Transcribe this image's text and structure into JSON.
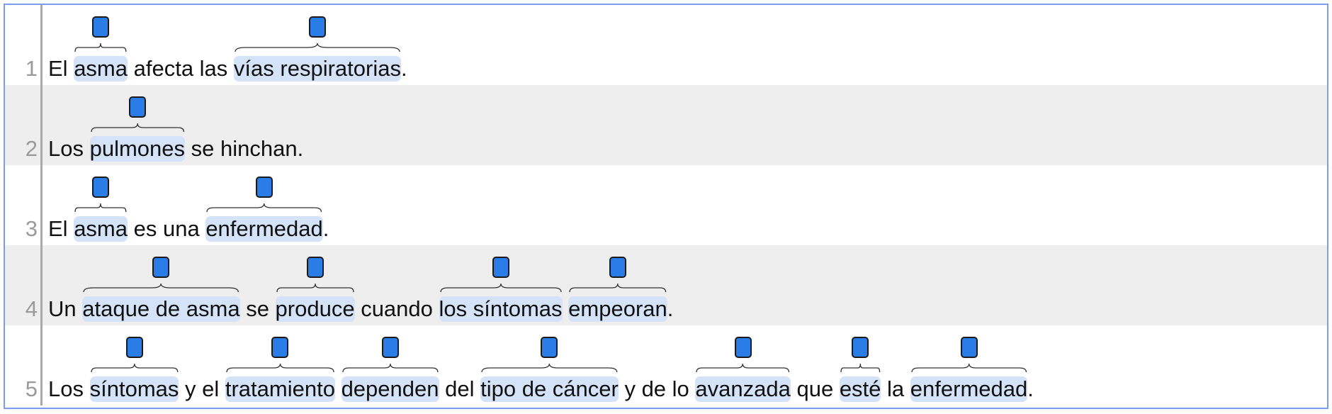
{
  "colors": {
    "frame_border": "#7b9cf0",
    "row_alt": "#eeeeee",
    "highlight": "#d5e3f8",
    "marker": "#2a7de6"
  },
  "sentences": [
    {
      "number": "1",
      "tokens": [
        {
          "t": "El "
        },
        {
          "t": "asma",
          "ann": true
        },
        {
          "t": " afecta las "
        },
        {
          "t": "vías respiratorias",
          "ann": true
        },
        {
          "t": "."
        }
      ]
    },
    {
      "number": "2",
      "tokens": [
        {
          "t": "Los "
        },
        {
          "t": "pulmones",
          "ann": true
        },
        {
          "t": " se hinchan."
        }
      ]
    },
    {
      "number": "3",
      "tokens": [
        {
          "t": "El "
        },
        {
          "t": "asma",
          "ann": true
        },
        {
          "t": " es una "
        },
        {
          "t": "enfermedad",
          "ann": true
        },
        {
          "t": "."
        }
      ]
    },
    {
      "number": "4",
      "tokens": [
        {
          "t": "Un "
        },
        {
          "t": "ataque de asma",
          "ann": true
        },
        {
          "t": " se "
        },
        {
          "t": "produce",
          "ann": true
        },
        {
          "t": " cuando "
        },
        {
          "t": "los síntomas",
          "ann": true
        },
        {
          "t": " "
        },
        {
          "t": "empeoran",
          "ann": true
        },
        {
          "t": "."
        }
      ]
    },
    {
      "number": "5",
      "tokens": [
        {
          "t": "Los "
        },
        {
          "t": "síntomas",
          "ann": true
        },
        {
          "t": " y el "
        },
        {
          "t": "tratamiento",
          "ann": true
        },
        {
          "t": " "
        },
        {
          "t": "dependen",
          "ann": true
        },
        {
          "t": " del "
        },
        {
          "t": "tipo de cáncer",
          "ann": true
        },
        {
          "t": " y de lo "
        },
        {
          "t": "avanzada",
          "ann": true
        },
        {
          "t": " que "
        },
        {
          "t": "esté",
          "ann": true
        },
        {
          "t": " la "
        },
        {
          "t": "enfermedad",
          "ann": true
        },
        {
          "t": "."
        }
      ]
    }
  ]
}
